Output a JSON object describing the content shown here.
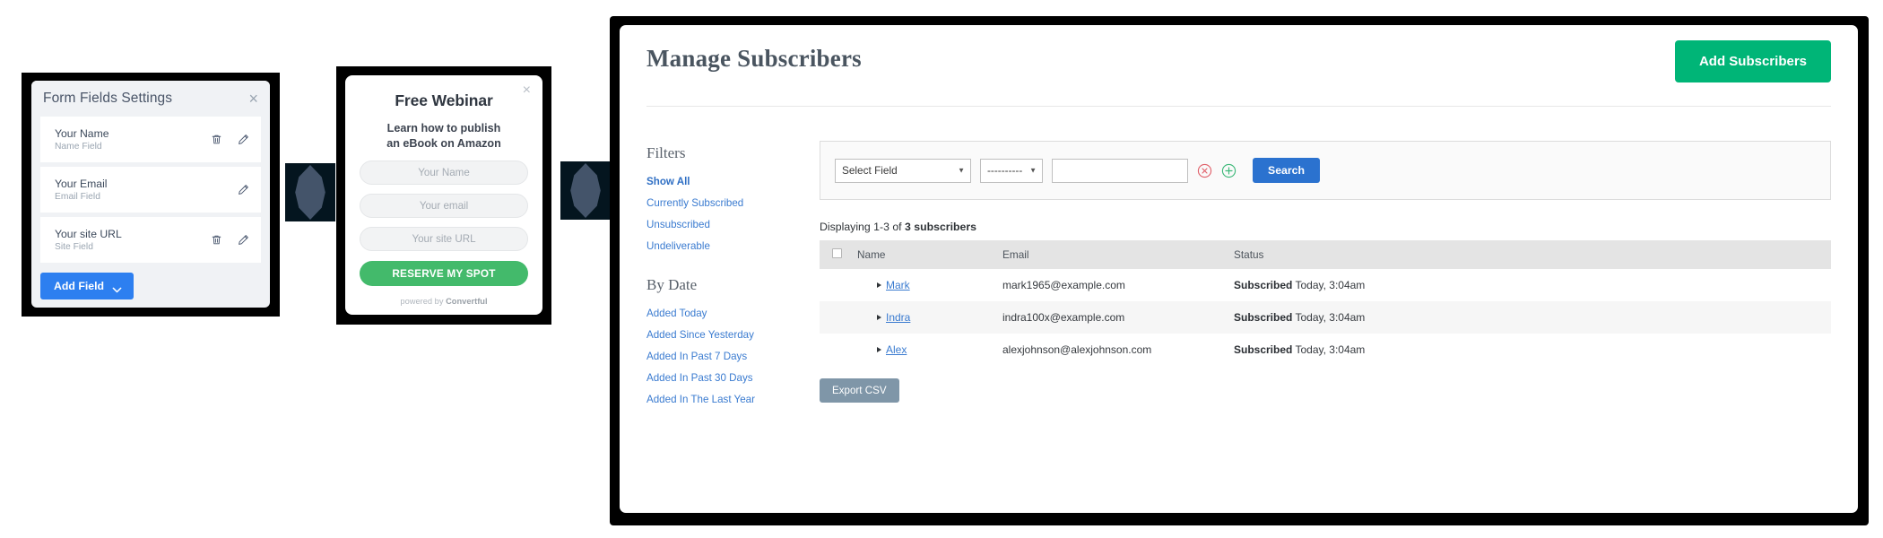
{
  "form_fields_panel": {
    "title": "Form Fields Settings",
    "close_label": "×",
    "fields": [
      {
        "label": "Your Name",
        "sub": "Name Field",
        "has_delete": true,
        "has_edit": true
      },
      {
        "label": "Your Email",
        "sub": "Email Field",
        "has_delete": false,
        "has_edit": true
      },
      {
        "label": "Your site URL",
        "sub": "Site Field",
        "has_delete": true,
        "has_edit": true
      }
    ],
    "add_field_label": "Add Field",
    "accent_color": "#2d7ff0"
  },
  "webinar_popup": {
    "close_label": "×",
    "title": "Free Webinar",
    "subtitle_line1": "Learn how to publish",
    "subtitle_line2": "an eBook on Amazon",
    "inputs": [
      {
        "placeholder": "Your Name",
        "value": ""
      },
      {
        "placeholder": "Your email",
        "value": ""
      },
      {
        "placeholder": "Your site URL",
        "value": ""
      }
    ],
    "cta_label": "RESERVE MY SPOT",
    "powered_prefix": "powered by ",
    "powered_brand": "Convertful",
    "cta_color": "#43ba6b"
  },
  "subscribers_panel": {
    "title": "Manage Subscribers",
    "add_subscribers_label": "Add Subscribers",
    "add_color": "#00b577",
    "sidebar": {
      "filters_heading": "Filters",
      "filters": [
        "Show All",
        "Currently Subscribed",
        "Unsubscribed",
        "Undeliverable"
      ],
      "active_filter": "Show All",
      "bydate_heading": "By Date",
      "bydate": [
        "Added Today",
        "Added Since Yesterday",
        "Added In Past 7 Days",
        "Added In Past 30 Days",
        "Added In The Last Year"
      ]
    },
    "search": {
      "field_select_value": "Select Field",
      "operator_select_value": "----------",
      "query_value": "",
      "query_placeholder": "",
      "search_label": "Search",
      "search_color": "#2b72cf",
      "remove_icon": "remove-condition-icon",
      "add_icon": "add-condition-icon"
    },
    "results_summary_prefix": "Displaying 1-3 of ",
    "results_summary_count": "3 subscribers",
    "table": {
      "columns": [
        "",
        "Name",
        "Email",
        "Status"
      ],
      "rows": [
        {
          "name": "Mark",
          "email": "mark1965@example.com",
          "status_strong": "Subscribed",
          "status_rest": " Today, 3:04am"
        },
        {
          "name": "Indra",
          "email": "indra100x@example.com",
          "status_strong": "Subscribed",
          "status_rest": " Today, 3:04am"
        },
        {
          "name": "Alex",
          "email": "alexjohnson@alexjohnson.com",
          "status_strong": "Subscribed",
          "status_rest": " Today, 3:04am"
        }
      ]
    },
    "export_label": "Export CSV",
    "export_color": "#7f96a8"
  },
  "decorations": {
    "block_bg": "#04151f",
    "diamond_fill": "#44546a"
  }
}
